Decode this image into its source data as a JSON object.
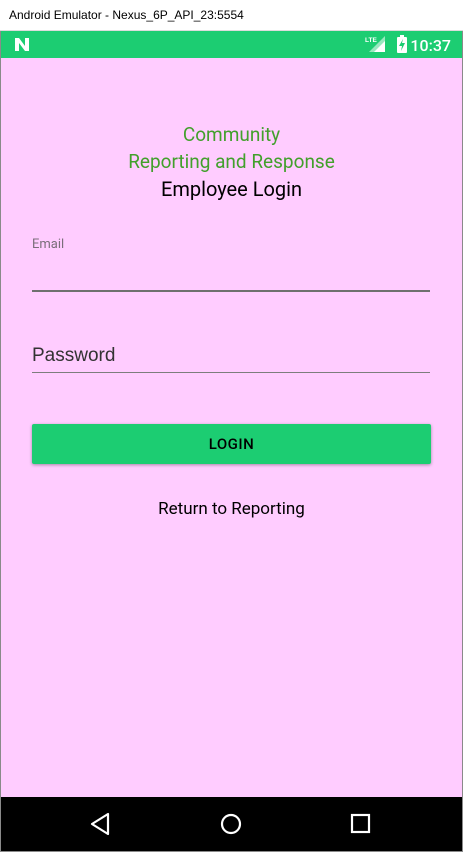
{
  "window": {
    "title": "Android Emulator - Nexus_6P_API_23:5554"
  },
  "statusbar": {
    "time": "10:37",
    "network_label": "LTE"
  },
  "header": {
    "line1": "Community",
    "line2": "Reporting and Response",
    "line3": "Employee Login"
  },
  "form": {
    "email_label": "Email",
    "email_value": "",
    "password_placeholder": "Password",
    "password_value": "",
    "login_label": "LOGIN",
    "return_label": "Return to Reporting"
  },
  "colors": {
    "accent": "#1ccd72",
    "background": "#ffccff",
    "header_green": "#42a02c"
  },
  "icons": {
    "status": [
      "notification-n-icon",
      "lte-signal-icon",
      "battery-charging-icon"
    ],
    "nav": [
      "back-icon",
      "home-icon",
      "recents-icon"
    ]
  }
}
